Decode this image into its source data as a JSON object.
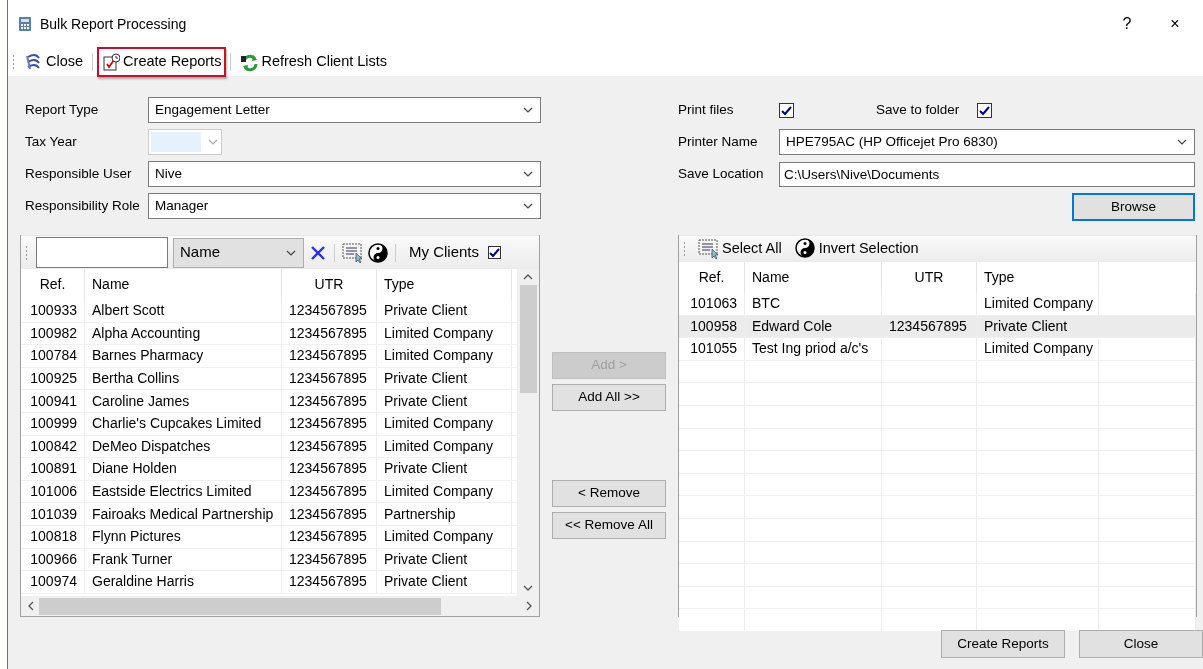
{
  "window": {
    "title": "Bulk Report Processing",
    "help": "?",
    "close": "×"
  },
  "toolbar": [
    {
      "label": "Close",
      "kind": "close",
      "highlighted": false
    },
    {
      "label": "Create Reports",
      "kind": "create",
      "highlighted": true
    },
    {
      "label": "Refresh Client Lists",
      "kind": "refresh",
      "highlighted": false
    }
  ],
  "report_fields": [
    {
      "label": "Report Type",
      "value": "Engagement Letter",
      "disabled": false
    },
    {
      "label": "Tax Year",
      "disabled": true
    },
    {
      "label": "Responsible User",
      "value": "Nive",
      "disabled": false
    },
    {
      "label": "Responsibility Role",
      "value": "Manager",
      "disabled": false
    }
  ],
  "output": {
    "print_files": {
      "label": "Print files",
      "checked": true
    },
    "save_to_folder": {
      "label": "Save to folder",
      "checked": true
    },
    "printer_name": {
      "label": "Printer Name",
      "value": "HPE795AC (HP Officejet Pro 6830)"
    },
    "save_location": {
      "label": "Save Location",
      "value": "C:\\Users\\Nive\\Documents"
    },
    "browse": "Browse"
  },
  "available": {
    "filter": "Name",
    "my_clients": {
      "label": "My Clients",
      "checked": true
    },
    "columns": [
      "Ref.",
      "Name",
      "UTR",
      "Type"
    ],
    "rows": [
      {
        "ref": "100933",
        "name": "Albert Scott",
        "utr": "1234567895",
        "type": "Private Client",
        "selected": false
      },
      {
        "ref": "100982",
        "name": "Alpha Accounting",
        "utr": "1234567895",
        "type": "Limited Company",
        "selected": false
      },
      {
        "ref": "100784",
        "name": "Barnes Pharmacy",
        "utr": "1234567895",
        "type": "Limited Company",
        "selected": false
      },
      {
        "ref": "100925",
        "name": "Bertha Collins",
        "utr": "1234567895",
        "type": "Private Client",
        "selected": false
      },
      {
        "ref": "100941",
        "name": "Caroline James",
        "utr": "1234567895",
        "type": "Private Client",
        "selected": false
      },
      {
        "ref": "100999",
        "name": "Charlie's Cupcakes Limited",
        "utr": "1234567895",
        "type": "Limited Company",
        "selected": false
      },
      {
        "ref": "100842",
        "name": "DeMeo Dispatches",
        "utr": "1234567895",
        "type": "Limited Company",
        "selected": false
      },
      {
        "ref": "100891",
        "name": "Diane Holden",
        "utr": "1234567895",
        "type": "Private Client",
        "selected": false
      },
      {
        "ref": "101006",
        "name": "Eastside Electrics Limited",
        "utr": "1234567895",
        "type": "Limited Company",
        "selected": false
      },
      {
        "ref": "101039",
        "name": "Fairoaks Medical Partnership",
        "utr": "1234567895",
        "type": "Partnership",
        "selected": false
      },
      {
        "ref": "100818",
        "name": "Flynn Pictures",
        "utr": "1234567895",
        "type": "Limited Company",
        "selected": false
      },
      {
        "ref": "100966",
        "name": "Frank Turner",
        "utr": "1234567895",
        "type": "Private Client",
        "selected": false
      },
      {
        "ref": "100974",
        "name": "Geraldine Harris",
        "utr": "1234567895",
        "type": "Private Client",
        "selected": false
      }
    ]
  },
  "transfer_buttons": [
    {
      "label": "Add >",
      "disabled": true
    },
    {
      "label": "Add All >>",
      "disabled": false
    },
    {
      "label": "< Remove",
      "disabled": false
    },
    {
      "label": "<< Remove All",
      "disabled": false
    }
  ],
  "chosen": {
    "toolbar": [
      {
        "label": "Select All",
        "kind": "select"
      },
      {
        "label": "Invert Selection",
        "kind": "invert"
      }
    ],
    "columns": [
      "Ref.",
      "Name",
      "UTR",
      "Type"
    ],
    "rows": [
      {
        "ref": "101063",
        "name": "BTC",
        "type": "Limited Company",
        "selected": false
      },
      {
        "ref": "100958",
        "name": "Edward Cole",
        "utr": "1234567895",
        "type": "Private Client",
        "selected": true
      },
      {
        "ref": "101055",
        "name": "Test Ing priod a/c's",
        "type": "Limited Company",
        "selected": false
      }
    ]
  },
  "buttons": [
    "Create Reports",
    "Close"
  ]
}
